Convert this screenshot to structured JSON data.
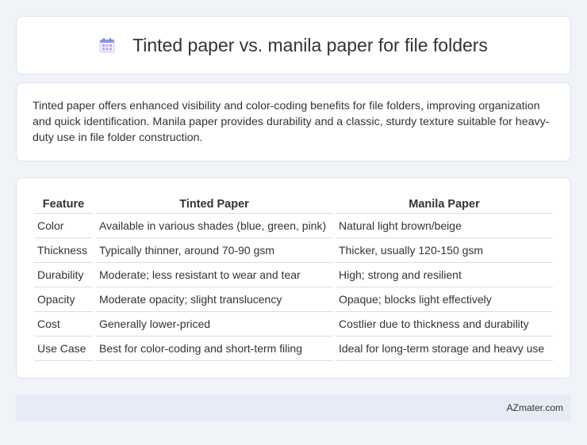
{
  "header": {
    "icon": "calendar-icon",
    "title": "Tinted paper vs. manila paper for file folders"
  },
  "description": "Tinted paper offers enhanced visibility and color-coding benefits for file folders, improving organization and quick identification. Manila paper provides durability and a classic, sturdy texture suitable for heavy-duty use in file folder construction.",
  "table": {
    "headers": [
      "Feature",
      "Tinted Paper",
      "Manila Paper"
    ],
    "rows": [
      [
        "Color",
        "Available in various shades (blue, green, pink)",
        "Natural light brown/beige"
      ],
      [
        "Thickness",
        "Typically thinner, around 70-90 gsm",
        "Thicker, usually 120-150 gsm"
      ],
      [
        "Durability",
        "Moderate; less resistant to wear and tear",
        "High; strong and resilient"
      ],
      [
        "Opacity",
        "Moderate opacity; slight translucency",
        "Opaque; blocks light effectively"
      ],
      [
        "Cost",
        "Generally lower-priced",
        "Costlier due to thickness and durability"
      ],
      [
        "Use Case",
        "Best for color-coding and short-term filing",
        "Ideal for long-term storage and heavy use"
      ]
    ]
  },
  "footer": {
    "brand": "AZmater.com"
  }
}
